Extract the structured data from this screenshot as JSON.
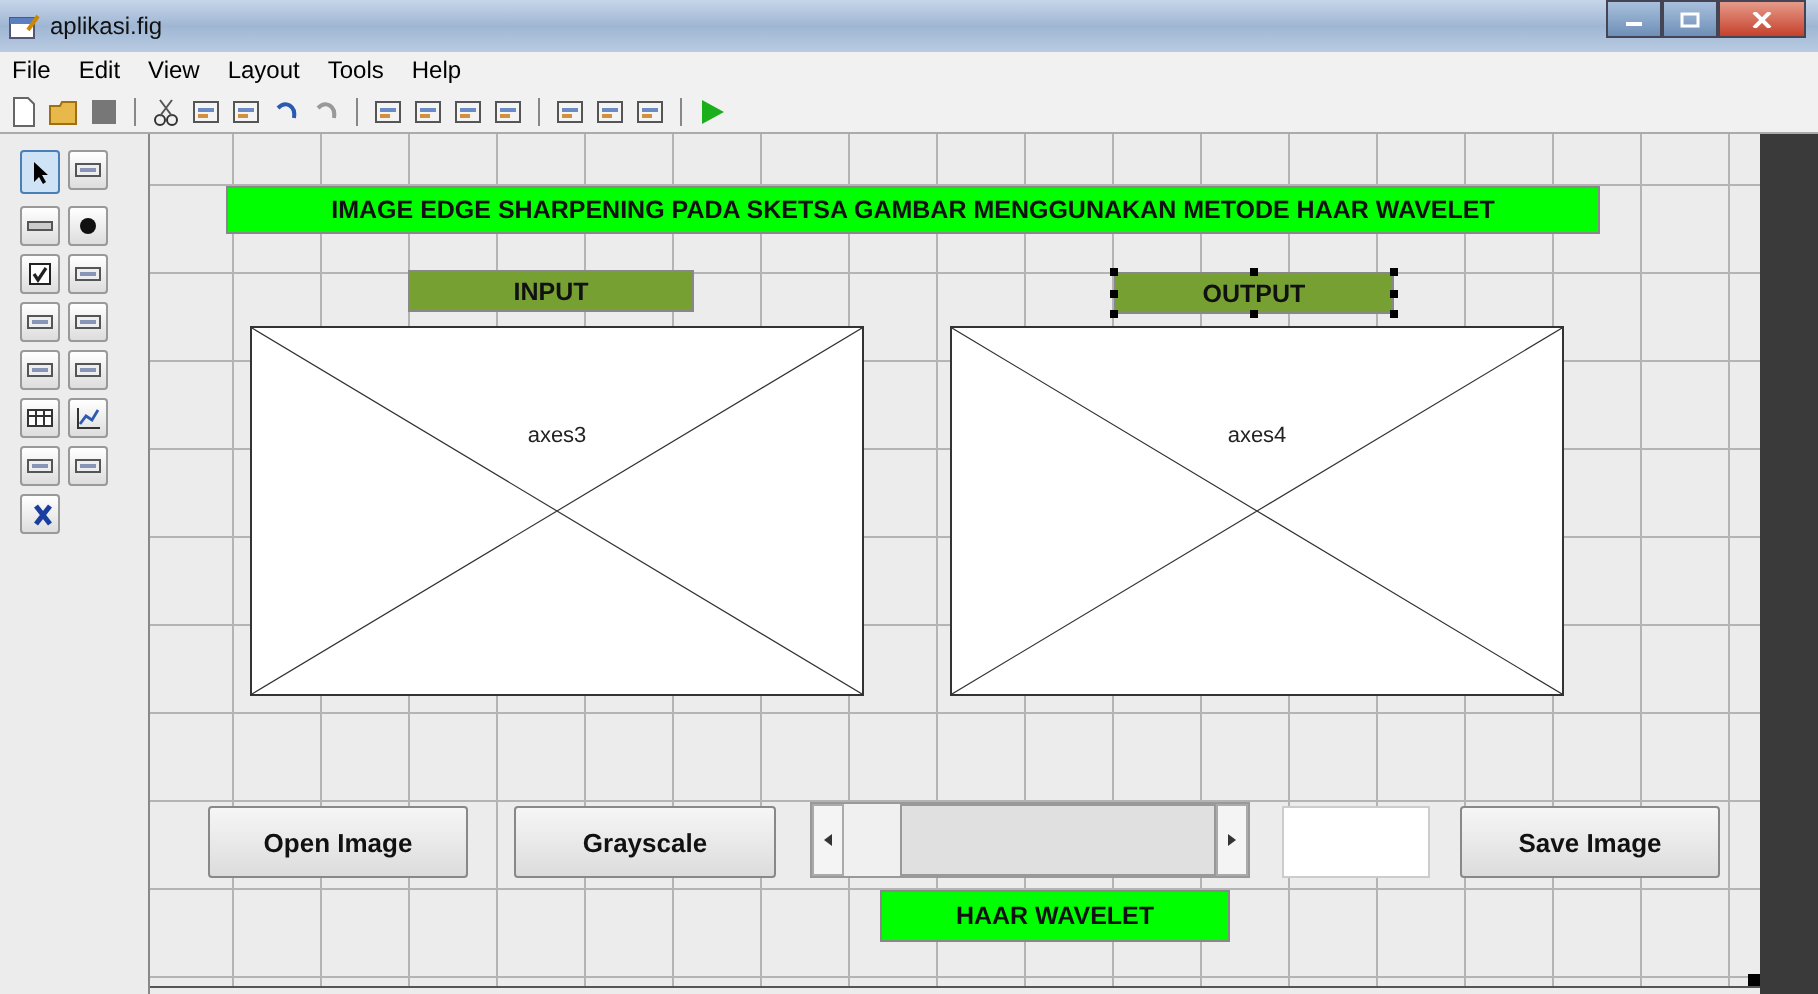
{
  "window": {
    "title": "aplikasi.fig"
  },
  "menu": [
    "File",
    "Edit",
    "View",
    "Layout",
    "Tools",
    "Help"
  ],
  "palette": [
    {
      "kind": "pointer",
      "selected": true
    },
    {
      "kind": "push",
      "selected": false
    },
    {
      "kind": "slider",
      "selected": false
    },
    {
      "kind": "radio",
      "selected": false
    },
    {
      "kind": "check",
      "selected": false
    },
    {
      "kind": "edit",
      "selected": false
    },
    {
      "kind": "text",
      "selected": false
    },
    {
      "kind": "popup",
      "selected": false
    },
    {
      "kind": "list",
      "selected": false
    },
    {
      "kind": "toggle",
      "selected": false
    },
    {
      "kind": "table",
      "selected": false
    },
    {
      "kind": "axes",
      "selected": false
    },
    {
      "kind": "panel",
      "selected": false
    },
    {
      "kind": "group",
      "selected": false
    },
    {
      "kind": "activex",
      "selected": false
    }
  ],
  "canvas": {
    "components": [
      {
        "kind": "label",
        "text": "IMAGE EDGE SHARPENING PADA SKETSA GAMBAR MENGGUNAKAN METODE HAAR WAVELET",
        "color": "#00ff00",
        "selected": false
      },
      {
        "kind": "label",
        "text": "INPUT",
        "color": "#77a033",
        "selected": false
      },
      {
        "kind": "label",
        "text": "OUTPUT",
        "color": "#77a033",
        "selected": true
      },
      {
        "kind": "axes",
        "text": "axes3",
        "selected": false
      },
      {
        "kind": "axes",
        "text": "axes4",
        "selected": false
      },
      {
        "kind": "button",
        "text": "Open Image",
        "selected": false
      },
      {
        "kind": "button",
        "text": "Grayscale",
        "selected": false
      },
      {
        "kind": "slider",
        "level": 1,
        "selected": false
      },
      {
        "kind": "edit",
        "selected": false
      },
      {
        "kind": "button",
        "text": "Save Image",
        "selected": false
      },
      {
        "kind": "label",
        "text": "HAAR WAVELET",
        "color": "#00ff00",
        "selected": false
      }
    ]
  }
}
